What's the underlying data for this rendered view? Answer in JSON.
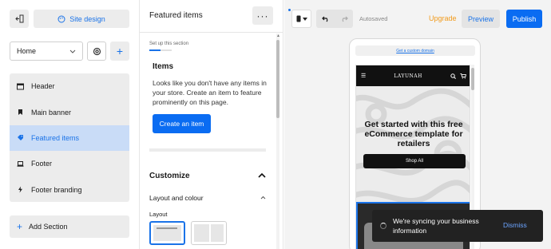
{
  "sidebar": {
    "site_design_label": "Site design",
    "page_select_value": "Home",
    "sections": [
      {
        "label": "Header",
        "icon": "header-icon"
      },
      {
        "label": "Main banner",
        "icon": "bookmark-icon"
      },
      {
        "label": "Featured items",
        "icon": "tag-icon",
        "active": true
      },
      {
        "label": "Footer",
        "icon": "laptop-icon"
      },
      {
        "label": "Footer branding",
        "icon": "lightning-icon"
      }
    ],
    "add_section_label": "Add Section"
  },
  "panel": {
    "title": "Featured items",
    "setup_label": "Set up this section",
    "items_heading": "Items",
    "items_text": "Looks like you don't have any items in your store. Create an item to feature prominently on this page.",
    "create_button": "Create an item",
    "customize_heading": "Customize",
    "layout_colour_label": "Layout and colour",
    "layout_label": "Layout"
  },
  "toolbar": {
    "autosaved": "Autosaved",
    "upgrade": "Upgrade",
    "preview": "Preview",
    "publish": "Publish"
  },
  "phone": {
    "custom_domain_link": "Get a custom domain",
    "logo": "LAYUNAH",
    "hero_title": "Get started with this free eCommerce template for retailers",
    "shop_button": "Shop All"
  },
  "toast": {
    "message": "We're syncing your business information",
    "dismiss": "Dismiss"
  },
  "colors": {
    "accent": "#1a73e8",
    "primary_button": "#0a6cf2",
    "upgrade": "#f29a1a",
    "active_item_bg": "#c9dcf7"
  }
}
